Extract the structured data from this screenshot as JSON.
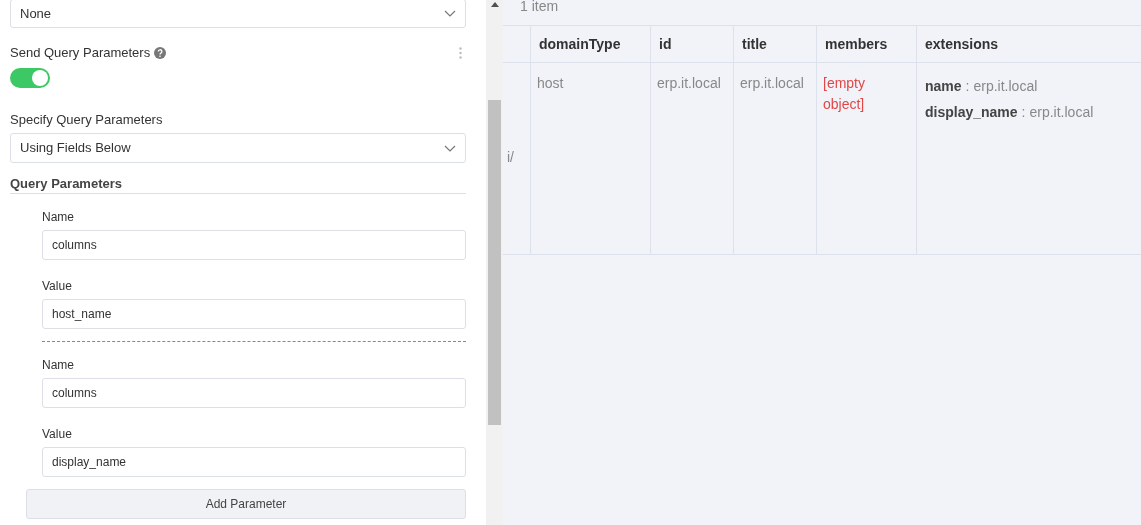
{
  "auth_select": {
    "value": "None"
  },
  "send_query": {
    "label": "Send Query Parameters",
    "on": true
  },
  "specify": {
    "label": "Specify Query Parameters",
    "value": "Using Fields Below"
  },
  "query_params": {
    "title": "Query Parameters",
    "params": [
      {
        "name_label": "Name",
        "name": "columns",
        "value_label": "Value",
        "value": "host_name"
      },
      {
        "name_label": "Name",
        "name": "columns",
        "value_label": "Value",
        "value": "display_name"
      }
    ],
    "add_button": "Add Parameter"
  },
  "results": {
    "count": "1 item",
    "columns": [
      "domainType",
      "id",
      "title",
      "members",
      "extensions"
    ],
    "rows": [
      {
        "column_1": "i/",
        "cells": [
          {
            "kind": "text",
            "text": "host"
          },
          {
            "kind": "text",
            "text": "erp.it.local"
          },
          {
            "kind": "text",
            "text": "erp.it.local"
          },
          {
            "kind": "empty",
            "text": "[empty object]"
          },
          {
            "kind": "fields",
            "fields": [
              {
                "key": "name",
                "separator": ":",
                "value": "erp.it.local"
              },
              {
                "key": "display_name",
                "separator": ":",
                "value": "erp.it.local"
              }
            ]
          }
        ]
      }
    ]
  }
}
